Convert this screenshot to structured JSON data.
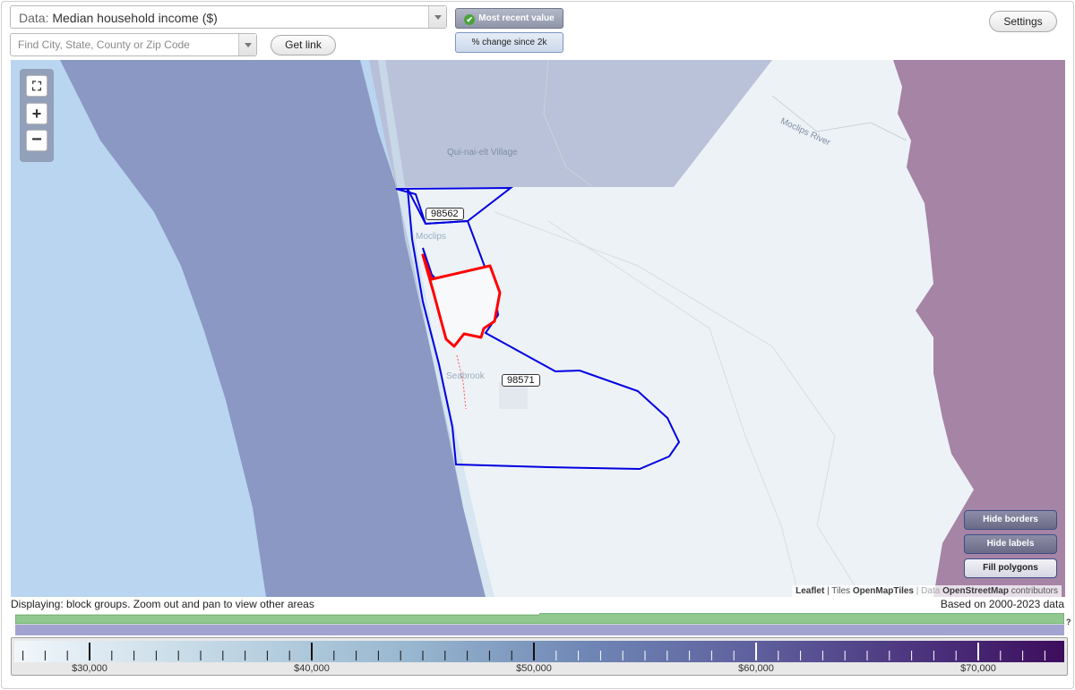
{
  "data_select": {
    "prefix": "Data:",
    "value": "Median household income ($)"
  },
  "search": {
    "placeholder": "Find City, State, County or Zip Code"
  },
  "buttons": {
    "get_link": "Get link",
    "settings": "Settings",
    "most_recent": "Most recent value",
    "pct_change": "% change since 2k",
    "hide_borders": "Hide borders",
    "hide_labels": "Hide labels",
    "fill_polygons": "Fill polygons"
  },
  "zoom": {
    "fullscreen": "⛶",
    "plus": "+",
    "minus": "−"
  },
  "map": {
    "place_labels": {
      "village": "Qui-nai-elt Village",
      "river": "Moclips River",
      "moclips": "Moclips",
      "seabrook": "Seabrook"
    },
    "zip_labels": [
      "98562",
      "98571"
    ],
    "attribution": {
      "leaflet": "Leaflet",
      "sep1": " | Tiles ",
      "tiles": "OpenMapTiles",
      "sep2": " | Data ",
      "data": "OpenStreetMap",
      "contrib": " contributors"
    }
  },
  "status": {
    "displaying": "Displaying: block groups. Zoom out and pan to view other areas",
    "based_on": "Based on 2000-2023 data",
    "coverage_help": "?"
  },
  "legend": {
    "tick_labels": [
      "$30,000",
      "$40,000",
      "$50,000",
      "$60,000",
      "$70,000"
    ]
  },
  "colors": {
    "highlight_border": "#ff0000",
    "zip_border": "#0000e0",
    "ocean": "#b7d3ef",
    "coverage_green": "#90c890",
    "coverage_purple": "#a3a3d2"
  }
}
